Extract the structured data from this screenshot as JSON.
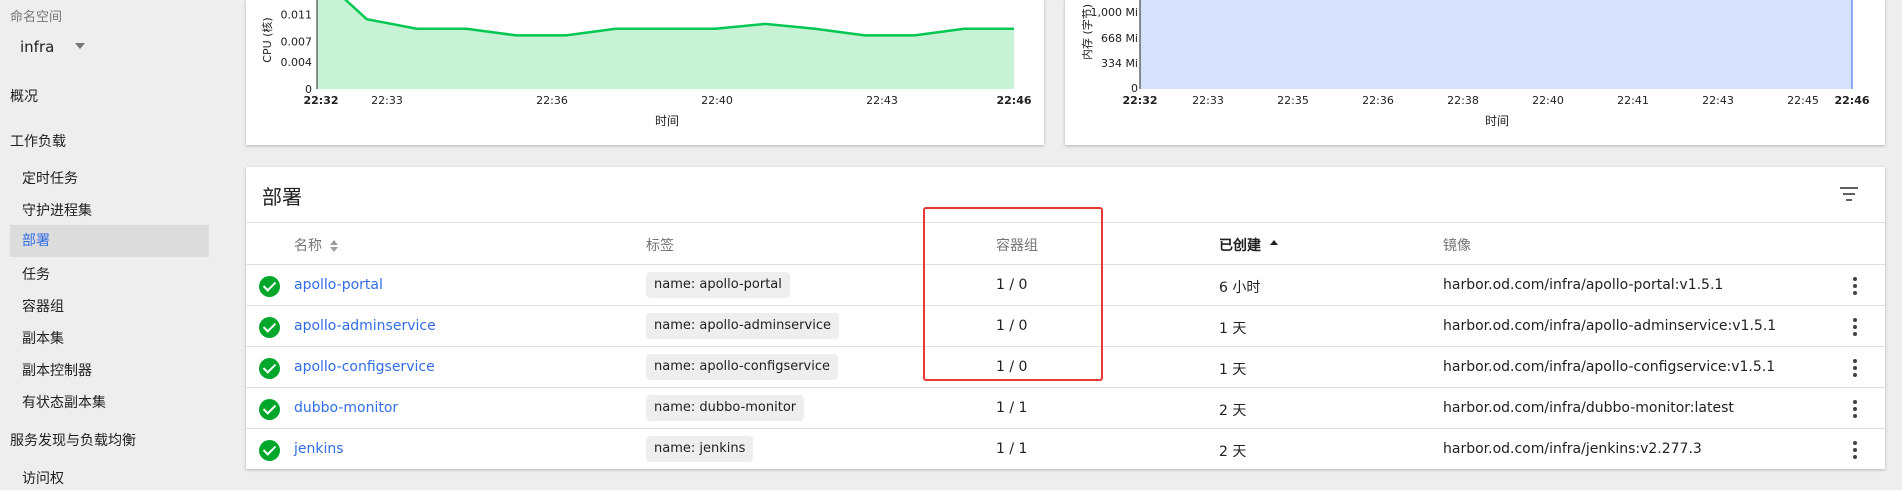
{
  "sidebar": {
    "namespace_label": "命名空间",
    "namespace_value": "infra",
    "overview": "概况",
    "workloads": "工作负载",
    "items": [
      "定时任务",
      "守护进程集",
      "部署",
      "任务",
      "容器组",
      "副本集",
      "副本控制器",
      "有状态副本集"
    ],
    "active_item": "部署",
    "discovery": "服务发现与负载均衡",
    "ingress": "访问权"
  },
  "cpu_chart": {
    "chart_data": {
      "type": "area",
      "ylabel": "CPU (核)",
      "xlabel": "时间",
      "y_ticks": [
        "0.011",
        "0.007",
        "0.004",
        "0"
      ],
      "x_ticks": [
        "22:32",
        "22:33",
        "22:36",
        "22:40",
        "22:43",
        "22:46"
      ],
      "values": [
        0.017,
        0.0103,
        0.0089,
        0.0089,
        0.0079,
        0.0079,
        0.0089,
        0.0089,
        0.0089,
        0.0096,
        0.0089,
        0.0079,
        0.0079,
        0.0089,
        0.0089
      ],
      "color": "#00c752",
      "fill": "#c8f2d6"
    }
  },
  "mem_chart": {
    "chart_data": {
      "type": "area",
      "ylabel": "内存 (字节)",
      "xlabel": "时间",
      "y_ticks": [
        "1,000 Mi",
        "668 Mi",
        "334 Mi",
        "0"
      ],
      "x_ticks": [
        "22:32",
        "22:33",
        "22:35",
        "22:36",
        "22:38",
        "22:40",
        "22:41",
        "22:43",
        "22:45",
        "22:46"
      ],
      "color": "#326de6",
      "fill": "#d6e2fb"
    }
  },
  "deployments": {
    "title": "部署",
    "columns": {
      "name": "名称",
      "labels": "标签",
      "pods": "容器组",
      "created": "已创建",
      "image": "镜像"
    },
    "rows": [
      {
        "name": "apollo-portal",
        "label": "name: apollo-portal",
        "pods": "1 / 0",
        "created": "6 小时",
        "image": "harbor.od.com/infra/apollo-portal:v1.5.1"
      },
      {
        "name": "apollo-adminservice",
        "label": "name: apollo-adminservice",
        "pods": "1 / 0",
        "created": "1 天",
        "image": "harbor.od.com/infra/apollo-adminservice:v1.5.1"
      },
      {
        "name": "apollo-configservice",
        "label": "name: apollo-configservice",
        "pods": "1 / 0",
        "created": "1 天",
        "image": "harbor.od.com/infra/apollo-configservice:v1.5.1"
      },
      {
        "name": "dubbo-monitor",
        "label": "name: dubbo-monitor",
        "pods": "1 / 1",
        "created": "2 天",
        "image": "harbor.od.com/infra/dubbo-monitor:latest"
      },
      {
        "name": "jenkins",
        "label": "name: jenkins",
        "pods": "1 / 1",
        "created": "2 天",
        "image": "harbor.od.com/infra/jenkins:v2.277.3"
      }
    ]
  }
}
